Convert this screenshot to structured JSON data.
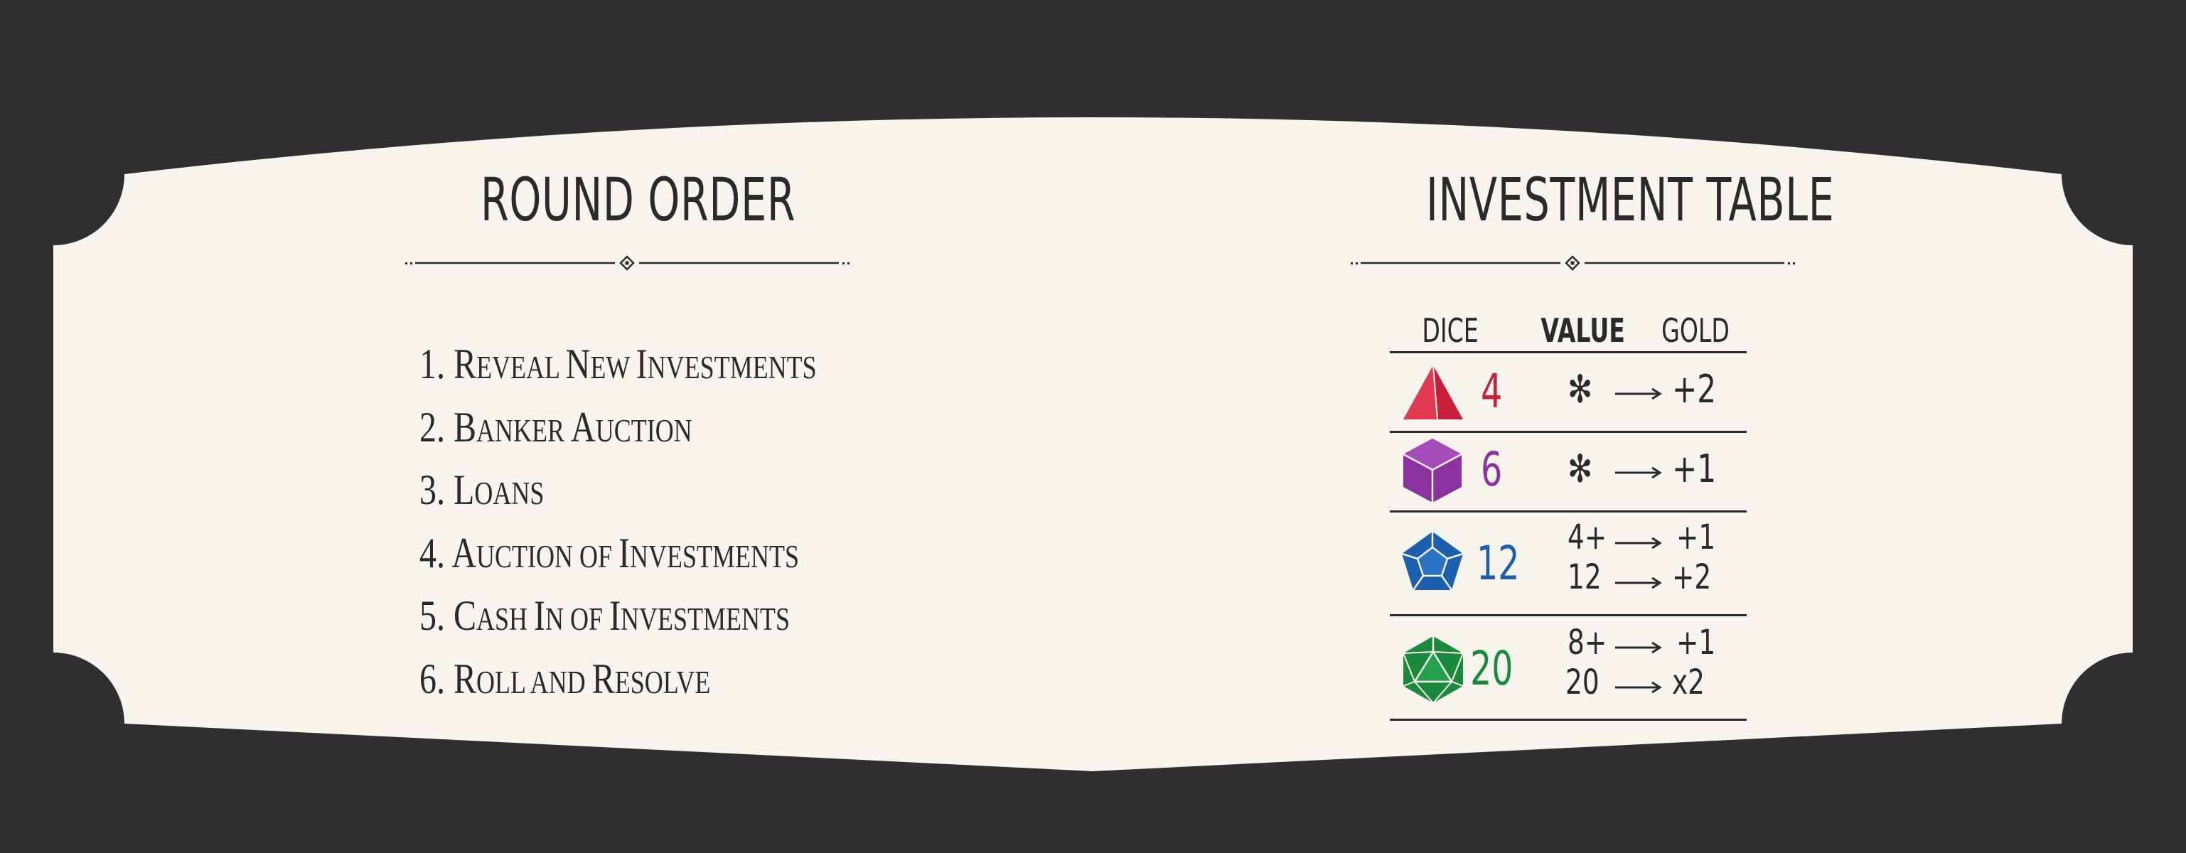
{
  "colors": {
    "background": "#312e2f",
    "card": "#f7f5ed",
    "ink": "#2b2a2a",
    "d4": "#c8203a",
    "d6": "#8b32a0",
    "d12": "#1c5fae",
    "d20": "#1b8a3d"
  },
  "round_order": {
    "title": "ROUND ORDER",
    "steps": [
      {
        "num": "1.",
        "first": "R",
        "rest": "EVEAL ",
        "first2": "N",
        "rest2": "EW ",
        "first3": "I",
        "rest3": "NVESTMENTS"
      },
      {
        "num": "2.",
        "first": "B",
        "rest": "ANKER ",
        "first2": "A",
        "rest2": "UCTION",
        "first3": "",
        "rest3": ""
      },
      {
        "num": "3.",
        "first": "L",
        "rest": "OANS",
        "first2": "",
        "rest2": "",
        "first3": "",
        "rest3": ""
      },
      {
        "num": "4.",
        "first": "A",
        "rest": "UCTION OF ",
        "first2": "I",
        "rest2": "NVESTMENTS",
        "first3": "",
        "rest3": ""
      },
      {
        "num": "5.",
        "first": "C",
        "rest": "ASH ",
        "first2": "I",
        "rest2": "N OF ",
        "first3": "I",
        "rest3": "NVESTMENTS"
      },
      {
        "num": "6.",
        "first": "R",
        "rest": "OLL AND ",
        "first2": "R",
        "rest2": "ESOLVE",
        "first3": "",
        "rest3": ""
      }
    ]
  },
  "investment_table": {
    "title": "INVESTMENT TABLE",
    "headers": {
      "dice": "DICE",
      "value": "VALUE",
      "gold": "GOLD"
    },
    "rows": [
      {
        "die": "4",
        "icon": "d4-icon",
        "lines": [
          {
            "value": "✻",
            "gold": "+2"
          }
        ]
      },
      {
        "die": "6",
        "icon": "d6-icon",
        "lines": [
          {
            "value": "✻",
            "gold": "+1"
          }
        ]
      },
      {
        "die": "12",
        "icon": "d12-icon",
        "lines": [
          {
            "value": "4+",
            "gold": "+1"
          },
          {
            "value": "12",
            "gold": "+2"
          }
        ]
      },
      {
        "die": "20",
        "icon": "d20-icon",
        "lines": [
          {
            "value": "8+",
            "gold": "+1"
          },
          {
            "value": "20",
            "gold": "x2"
          }
        ]
      }
    ]
  }
}
